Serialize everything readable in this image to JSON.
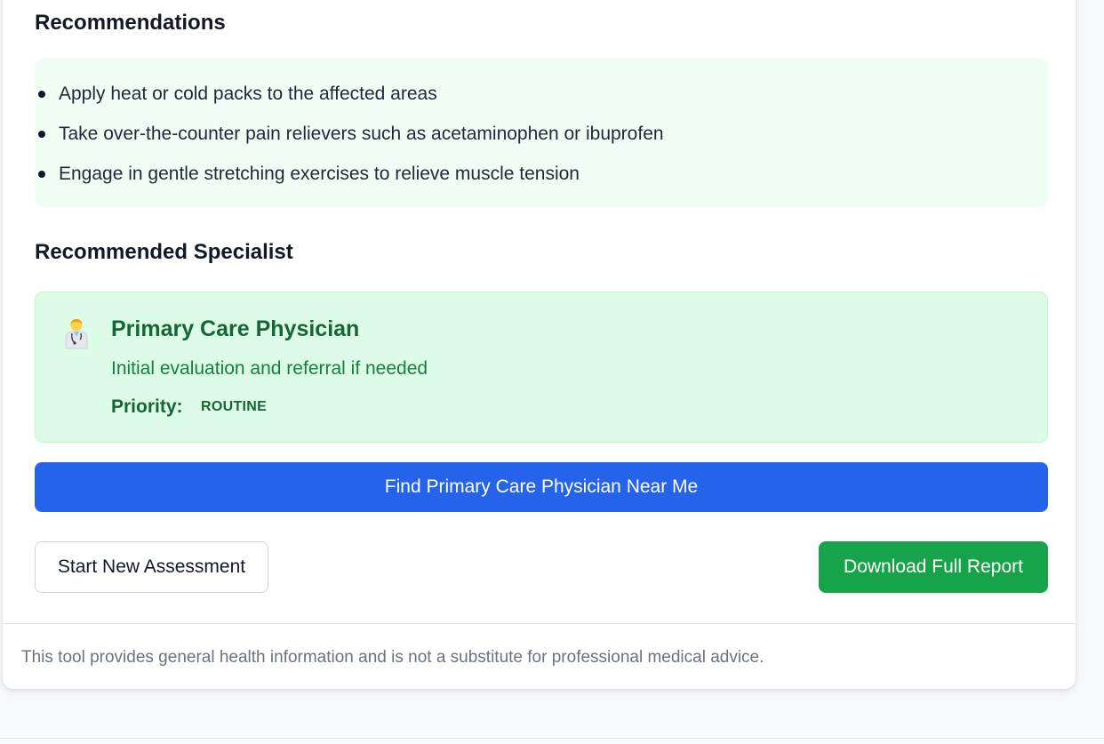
{
  "recommendations": {
    "title": "Recommendations",
    "items": [
      "Apply heat or cold packs to the affected areas",
      "Take over-the-counter pain relievers such as acetaminophen or ibuprofen",
      "Engage in gentle stretching exercises to relieve muscle tension"
    ]
  },
  "specialist": {
    "section_title": "Recommended Specialist",
    "icon": "doctor-icon",
    "name": "Primary Care Physician",
    "description": "Initial evaluation and referral if needed",
    "priority_label": "Priority:",
    "priority_value": "ROUTINE"
  },
  "actions": {
    "find_label": "Find Primary Care Physician Near Me",
    "new_assessment_label": "Start New Assessment",
    "download_label": "Download Full Report"
  },
  "footer": {
    "disclaimer": "This tool provides general health information and is not a substitute for professional medical advice."
  },
  "colors": {
    "primary_blue": "#2563eb",
    "success_green": "#16a34a",
    "specialist_bg": "#dcfce7",
    "recommendation_bg": "#f0fdf4"
  }
}
